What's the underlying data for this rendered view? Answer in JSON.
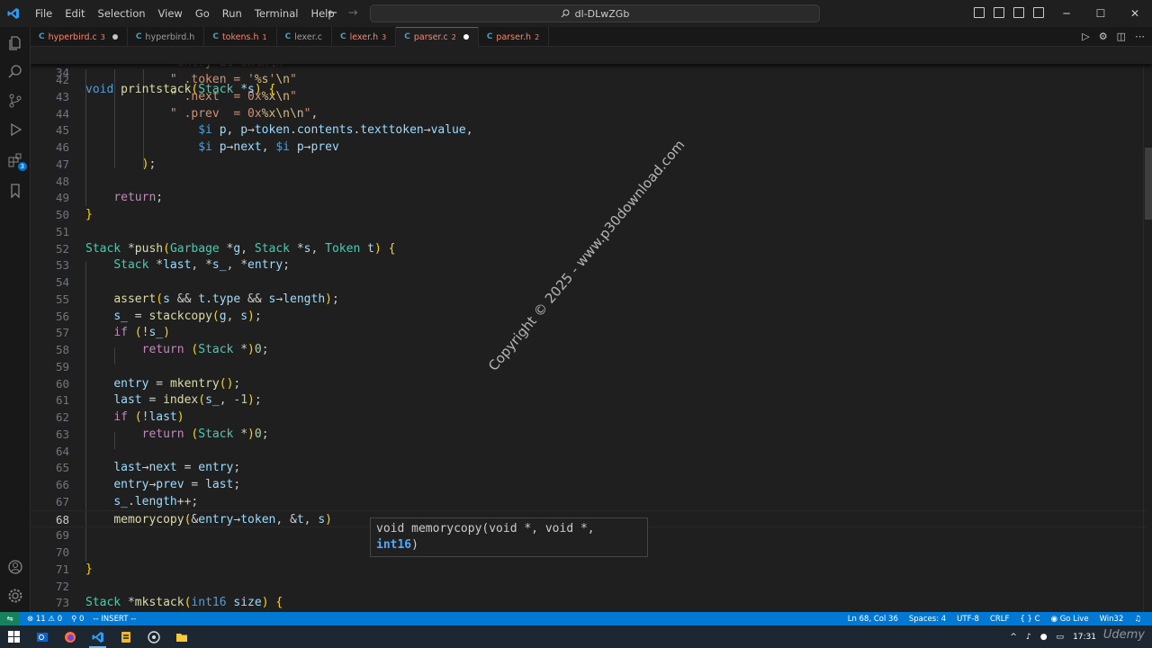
{
  "titlebar": {
    "menu": [
      "File",
      "Edit",
      "Selection",
      "View",
      "Go",
      "Run",
      "Terminal",
      "Help"
    ],
    "search": "dl-DLwZGb"
  },
  "tabs": [
    {
      "name": "hyperbird.c",
      "count": "3",
      "error": true,
      "dirty": true,
      "active": false
    },
    {
      "name": "hyperbird.h",
      "count": "",
      "error": false,
      "dirty": false,
      "active": false
    },
    {
      "name": "tokens.h",
      "count": "1",
      "error": true,
      "dirty": false,
      "active": false
    },
    {
      "name": "lexer.c",
      "count": "",
      "error": false,
      "dirty": false,
      "active": false
    },
    {
      "name": "lexer.h",
      "count": "3",
      "error": true,
      "dirty": false,
      "active": false
    },
    {
      "name": "parser.c",
      "count": "2",
      "error": true,
      "dirty": true,
      "active": true
    },
    {
      "name": "parser.h",
      "count": "2",
      "error": true,
      "dirty": false,
      "active": false
    }
  ],
  "sticky": {
    "ln": "34",
    "text": "void printstack(Stack *s) {"
  },
  "lines": [
    {
      "ln": "42",
      "text": "            \" .token = '%s'\\n\""
    },
    {
      "ln": "43",
      "text": "            \" .next  = 0x%x\\n\""
    },
    {
      "ln": "44",
      "text": "            \" .prev  = 0x%x\\n\\n\","
    },
    {
      "ln": "45",
      "text": "                $i p, p→token.contents.texttoken→value,"
    },
    {
      "ln": "46",
      "text": "                $i p→next, $i p→prev"
    },
    {
      "ln": "47",
      "text": "        );"
    },
    {
      "ln": "48",
      "text": ""
    },
    {
      "ln": "49",
      "text": "    return;"
    },
    {
      "ln": "50",
      "text": "}"
    },
    {
      "ln": "51",
      "text": ""
    },
    {
      "ln": "52",
      "text": "Stack *push(Garbage *g, Stack *s, Token t) {"
    },
    {
      "ln": "53",
      "text": "    Stack *last, *s_, *entry;"
    },
    {
      "ln": "54",
      "text": ""
    },
    {
      "ln": "55",
      "text": "    assert(s && t.type && s→length);"
    },
    {
      "ln": "56",
      "text": "    s_ = stackcopy(g, s);"
    },
    {
      "ln": "57",
      "text": "    if (!s_)"
    },
    {
      "ln": "58",
      "text": "        return (Stack *)0;"
    },
    {
      "ln": "59",
      "text": ""
    },
    {
      "ln": "60",
      "text": "    entry = mkentry();"
    },
    {
      "ln": "61",
      "text": "    last = index(s_, -1);"
    },
    {
      "ln": "62",
      "text": "    if (!last)"
    },
    {
      "ln": "63",
      "text": "        return (Stack *)0;"
    },
    {
      "ln": "64",
      "text": ""
    },
    {
      "ln": "65",
      "text": "    last→next = entry;"
    },
    {
      "ln": "66",
      "text": "    entry→prev = last;"
    },
    {
      "ln": "67",
      "text": "    s_.length++;"
    },
    {
      "ln": "68",
      "text": "    memorycopy(&entry→token, &t, s)"
    },
    {
      "ln": "69",
      "text": ""
    },
    {
      "ln": "70",
      "text": ""
    },
    {
      "ln": "71",
      "text": "}"
    },
    {
      "ln": "72",
      "text": ""
    },
    {
      "ln": "73",
      "text": "Stack *mkstack(int16 size) {"
    }
  ],
  "hover": {
    "line1": "void memorycopy(void *, void *,",
    "param": "int16",
    "close": ")"
  },
  "watermark": "Copyright © 2025 - www.p30download.com",
  "status": {
    "errors": "11",
    "warnings": "0",
    "ports": "0",
    "mode": "-- INSERT --",
    "position": "Ln 68, Col 36",
    "spaces": "Spaces: 4",
    "encoding": "UTF-8",
    "eol": "CRLF",
    "lang": "C",
    "golive": "Go Live",
    "platform": "Win32"
  },
  "taskbar": {
    "time": "17:31",
    "brand": "Udemy"
  }
}
